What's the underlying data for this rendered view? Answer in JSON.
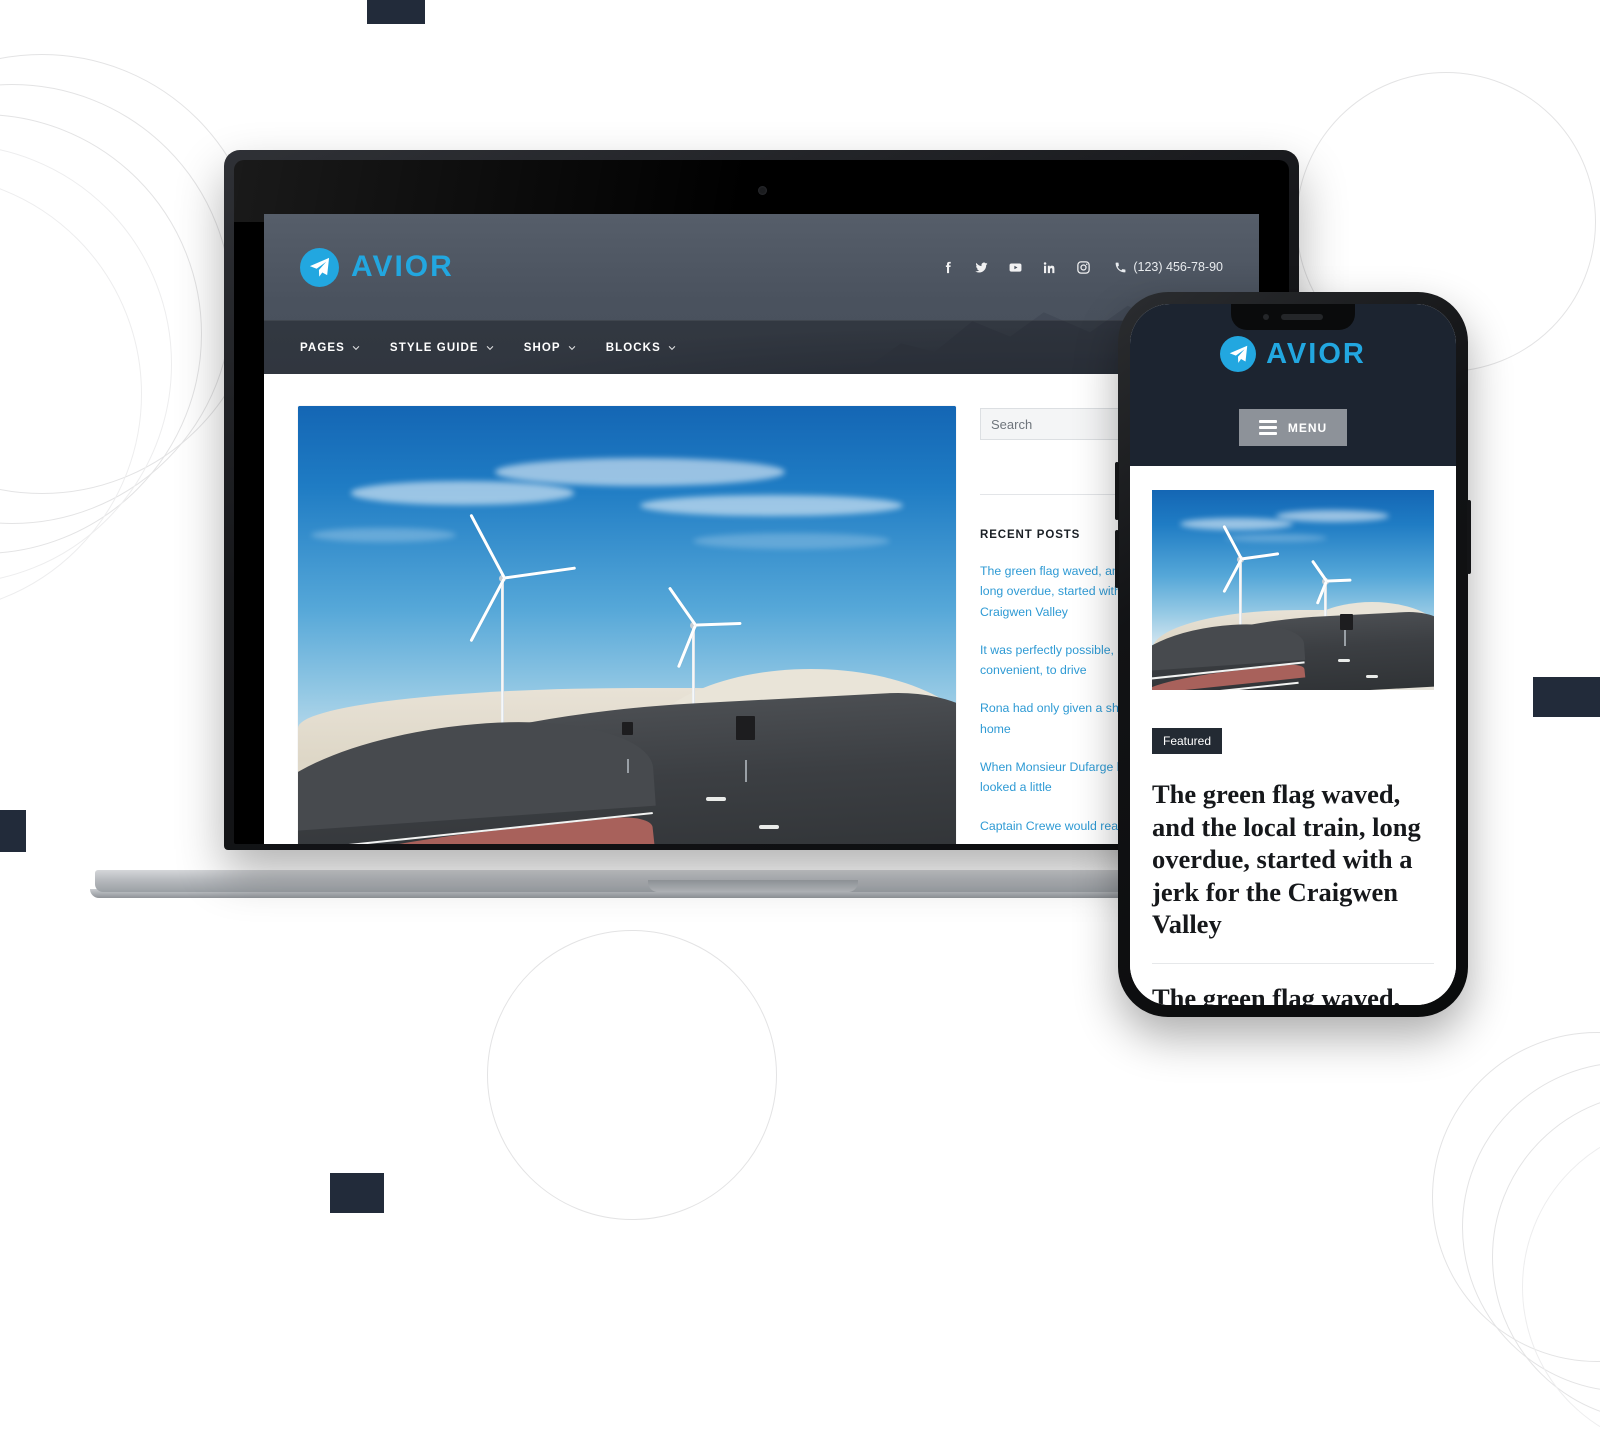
{
  "brand": {
    "name": "AVIOR",
    "logo_icon": "paper-plane-icon",
    "accent_color": "#22a7e0"
  },
  "desktop": {
    "header": {
      "social": [
        {
          "name": "facebook-icon",
          "label": "Facebook"
        },
        {
          "name": "twitter-icon",
          "label": "Twitter"
        },
        {
          "name": "youtube-icon",
          "label": "YouTube"
        },
        {
          "name": "linkedin-icon",
          "label": "LinkedIn"
        },
        {
          "name": "instagram-icon",
          "label": "Instagram"
        }
      ],
      "phone": "(123) 456-78-90"
    },
    "nav": [
      {
        "label": "PAGES",
        "has_dropdown": true
      },
      {
        "label": "STYLE GUIDE",
        "has_dropdown": true
      },
      {
        "label": "SHOP",
        "has_dropdown": true
      },
      {
        "label": "BLOCKS",
        "has_dropdown": true
      }
    ],
    "sidebar": {
      "search_placeholder": "Search",
      "recent_posts_title": "RECENT POSTS",
      "recent_posts": [
        "The green flag waved, and the local train, long overdue, started with a jerk for the Craigwen Valley",
        "It was perfectly possible, and much more convenient, to drive",
        "Rona had only given a short account of her home",
        "When Monsieur Dufarge looked at Sara, she looked a little",
        "Captain Crewe would read"
      ]
    },
    "hero_alt": "Wind turbines beside a curving coastal road"
  },
  "mobile": {
    "menu_label": "MENU",
    "menu_icon": "hamburger-icon",
    "badge": "Featured",
    "post_title": "The green flag waved, and the local train, long overdue, started with a jerk for the Craigwen Valley",
    "next_post_title": "The green flag waved, and the local train, long overdue, started with a jerk for the",
    "thumb_alt": "Wind turbines beside a curving coastal road"
  },
  "decor": {
    "square_color": "#222b3a",
    "ring_color": "#e3e3e4"
  }
}
